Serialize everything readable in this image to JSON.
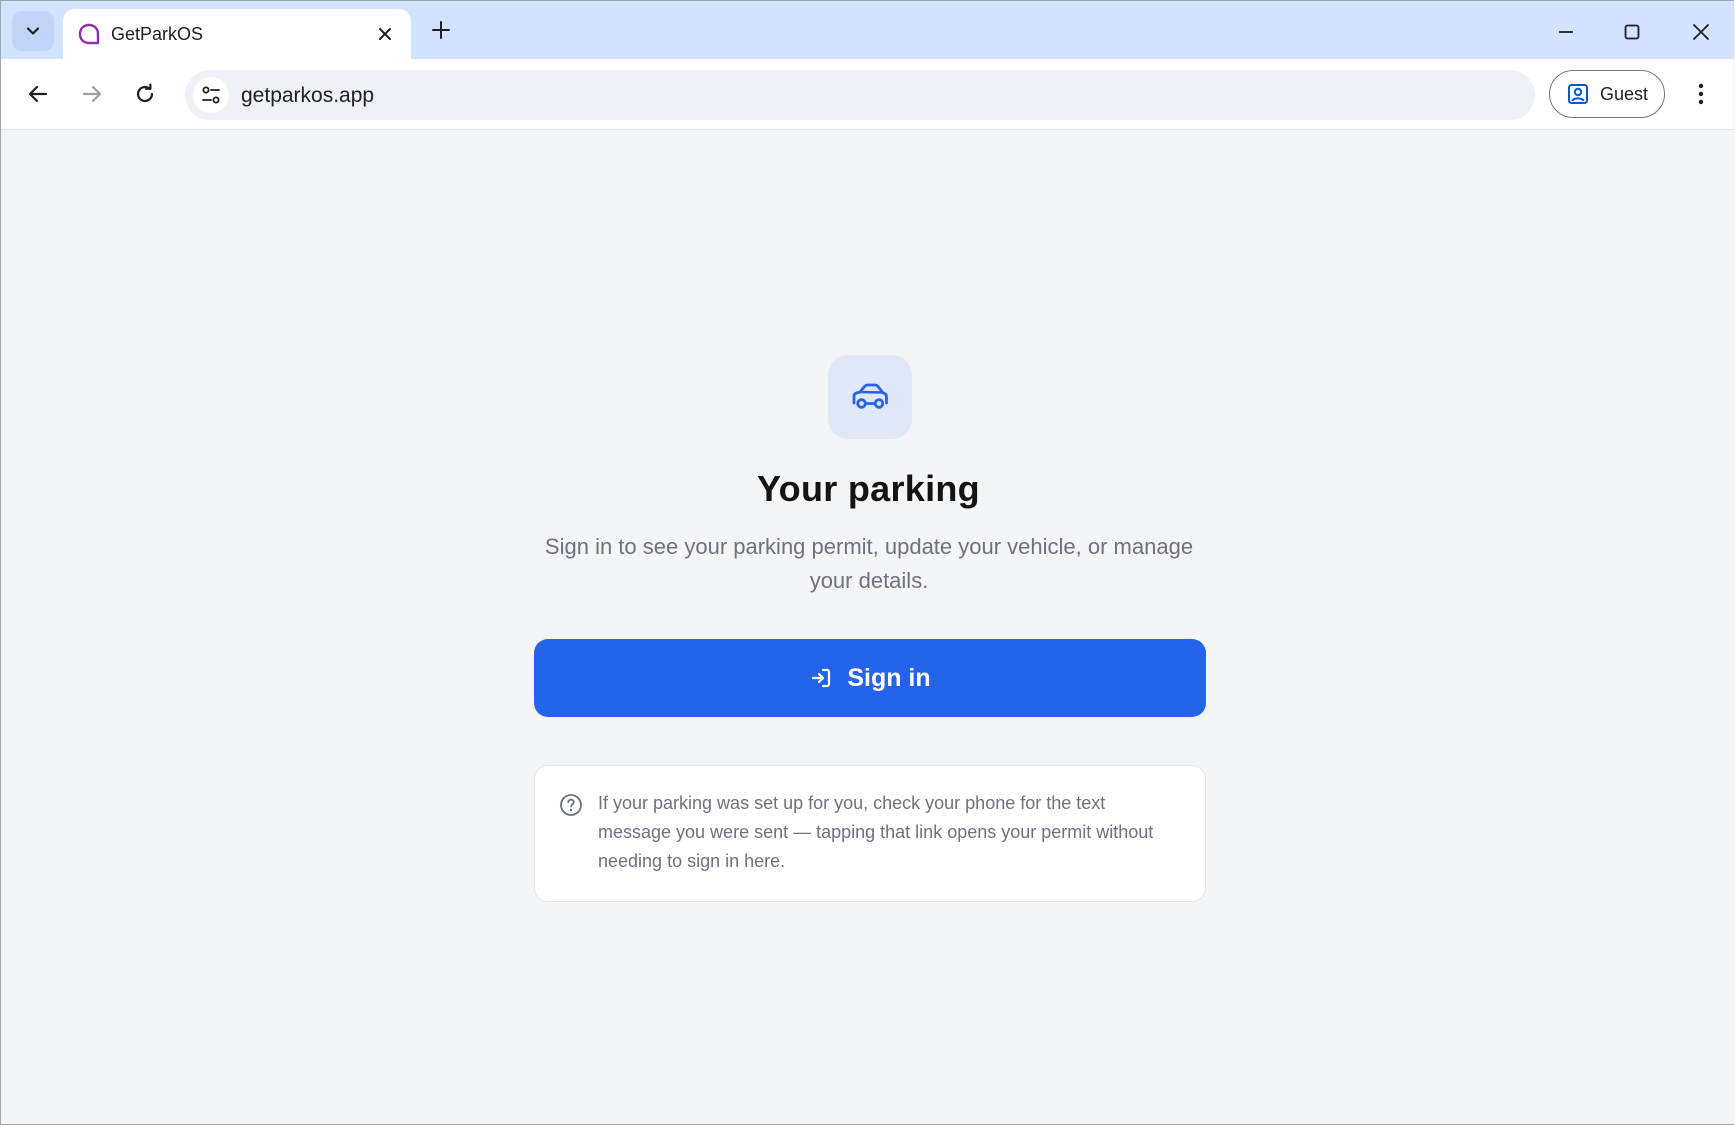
{
  "browser": {
    "tab": {
      "title": "GetParkOS"
    },
    "address_bar": {
      "url": "getparkos.app"
    },
    "profile": {
      "label": "Guest"
    }
  },
  "page": {
    "title": "Your parking",
    "subtitle": "Sign in to see your parking permit, update your vehicle, or manage your details.",
    "sign_in_button": {
      "label": "Sign in"
    },
    "info_card": {
      "text": "If your parking was set up for you, check your phone for the text message you were sent — tapping that link opens your permit without needing to sign in here."
    }
  },
  "colors": {
    "accent": "#2563eb",
    "tab_strip": "#d3e3fd",
    "page_background": "#f4f5f7",
    "muted_text": "#6b7280",
    "favicon": "#8e2fa8"
  },
  "icons": {
    "tab_search": "chevron-down-icon",
    "favicon": "parkos-logo-icon",
    "tab_close": "close-icon",
    "new_tab": "plus-icon",
    "back": "arrow-left-icon",
    "forward": "arrow-right-icon",
    "reload": "reload-icon",
    "site_info": "tune-icon",
    "profile": "account-box-icon",
    "menu": "more-vert-icon",
    "hero": "car-icon",
    "sign_in": "login-icon",
    "help": "help-circle-icon"
  }
}
